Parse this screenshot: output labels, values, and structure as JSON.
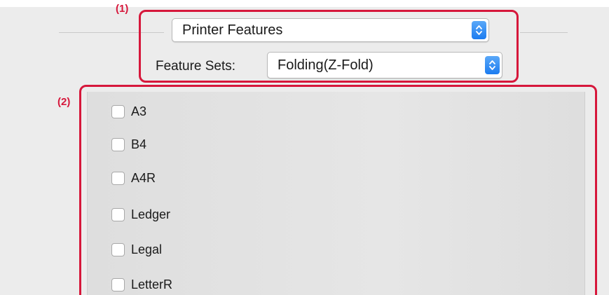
{
  "callouts": {
    "marker_1": "(1)",
    "marker_2": "(2)",
    "color": "#d6173b"
  },
  "printer_features_popup": {
    "selected": "Printer Features",
    "icon": "up-down-stepper-icon"
  },
  "feature_sets": {
    "label": "Feature Sets:",
    "selected": "Folding(Z-Fold)",
    "icon": "up-down-stepper-icon"
  },
  "paper_sizes": [
    {
      "label": "A3",
      "checked": false
    },
    {
      "label": "B4",
      "checked": false
    },
    {
      "label": "A4R",
      "checked": false
    },
    {
      "label": "Ledger",
      "checked": false
    },
    {
      "label": "Legal",
      "checked": false
    },
    {
      "label": "LetterR",
      "checked": false
    }
  ],
  "colors": {
    "accent_blue": "#1c7cf0",
    "panel_gray": "#ececec"
  }
}
